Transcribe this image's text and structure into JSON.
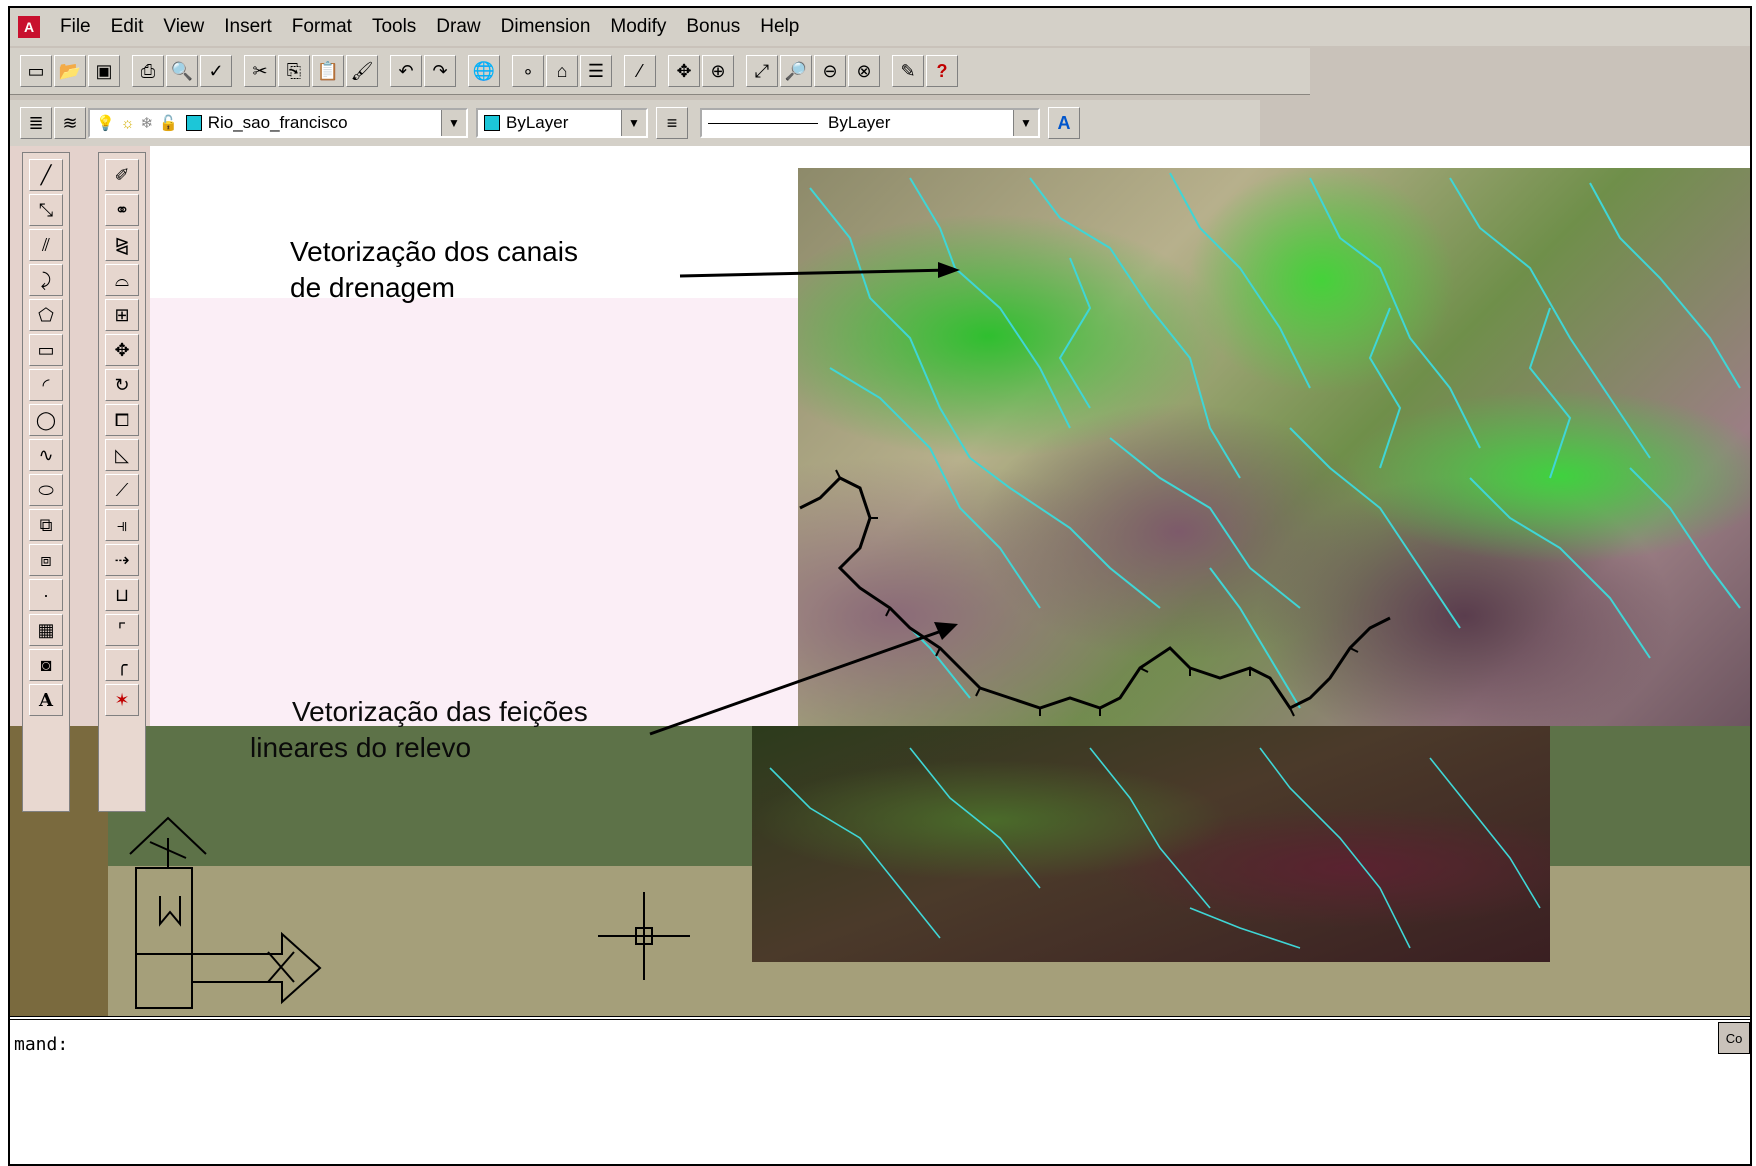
{
  "menubar": {
    "items": [
      "File",
      "Edit",
      "View",
      "Insert",
      "Format",
      "Tools",
      "Draw",
      "Dimension",
      "Modify",
      "Bonus",
      "Help"
    ]
  },
  "toolbar2": {
    "layer_name": "Rio_sao_francisco",
    "color_value": "ByLayer",
    "linetype_value": "ByLayer",
    "color_swatch": "#1cc6d8"
  },
  "annotations": {
    "drainage_line1": "Vetorização dos canais",
    "drainage_line2": "de drenagem",
    "relief_line1": "Vetorização das feições",
    "relief_line2": "lineares do relevo"
  },
  "command_line": {
    "prompt": "mand:",
    "corner": "Co"
  },
  "colors": {
    "drainage": "#3fd6d6",
    "feature_line": "#000000"
  }
}
